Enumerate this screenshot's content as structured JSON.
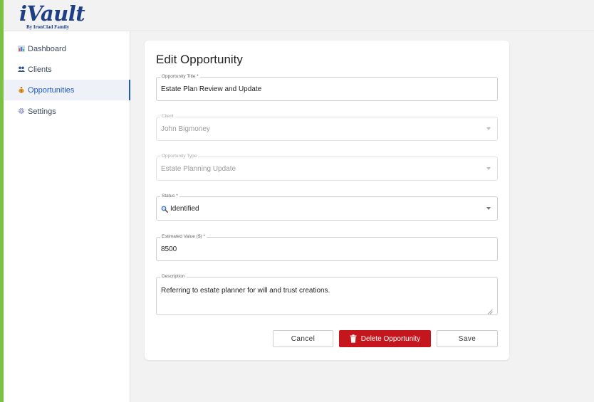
{
  "app": {
    "logo_main": "iVault",
    "logo_sub": "By IronClad Family",
    "accent_color": "#7cc242",
    "brand_color": "#1d3f86"
  },
  "sidebar": {
    "items": [
      {
        "label": "Dashboard",
        "icon": "bar-chart-icon"
      },
      {
        "label": "Clients",
        "icon": "people-icon"
      },
      {
        "label": "Opportunities",
        "icon": "money-bag-icon",
        "active": true
      },
      {
        "label": "Settings",
        "icon": "gear-icon"
      }
    ],
    "active_color": "#1f5bbf"
  },
  "form": {
    "title": "Edit Opportunity",
    "fields": {
      "title": {
        "label": "Opportunity Title *",
        "value": "Estate Plan Review and Update"
      },
      "client": {
        "label": "Client",
        "value": "John Bigmoney",
        "disabled": true
      },
      "type": {
        "label": "Opportunity Type",
        "value": "Estate Planning Update",
        "disabled": true
      },
      "status": {
        "label": "Status *",
        "value": "Identified",
        "icon": "magnifier-icon"
      },
      "value": {
        "label": "Estimated Value ($) *",
        "value": "8500"
      },
      "description": {
        "label": "Description",
        "value": "Referring to estate planner for will and trust creations."
      }
    },
    "buttons": {
      "cancel": "Cancel",
      "delete": "Delete Opportunity",
      "save": "Save"
    },
    "delete_color": "#c5161d"
  }
}
